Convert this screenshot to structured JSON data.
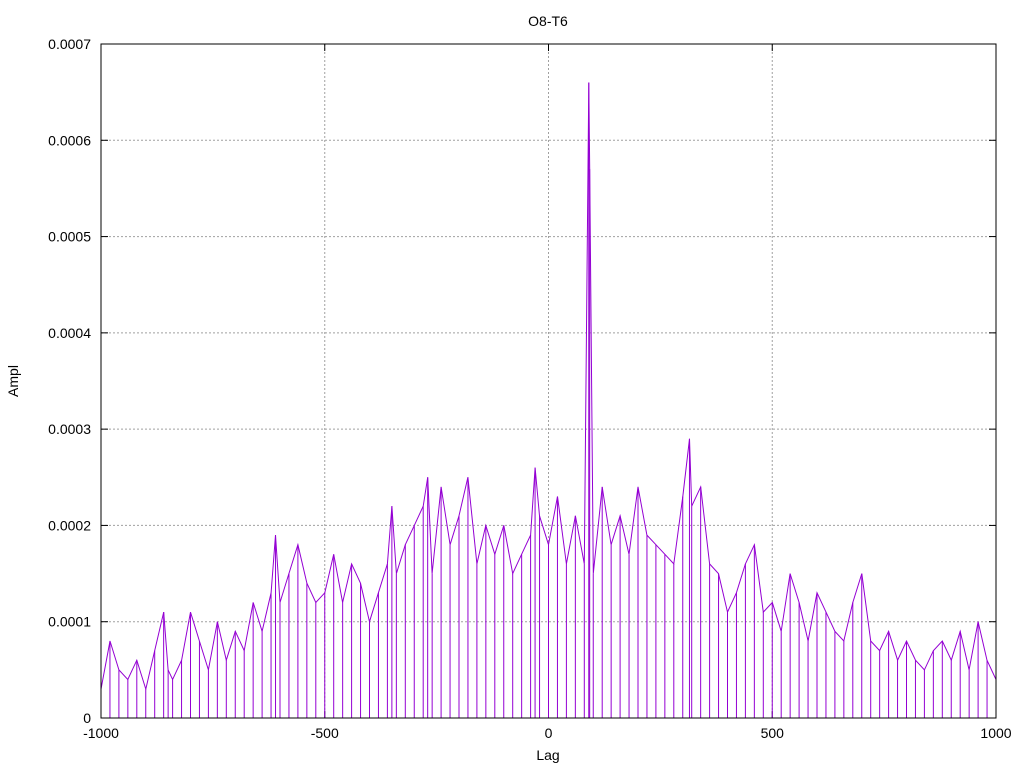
{
  "chart_data": {
    "type": "line",
    "title": "O8-T6",
    "xlabel": "Lag",
    "ylabel": "Ampl",
    "xlim": [
      -1000,
      1000
    ],
    "ylim": [
      0,
      0.0007
    ],
    "x_ticks": [
      -1000,
      -500,
      0,
      500,
      1000
    ],
    "x_tick_labels": [
      "-1000",
      "-500",
      "0",
      "500",
      "1000"
    ],
    "y_ticks": [
      0,
      0.0001,
      0.0002,
      0.0003,
      0.0004,
      0.0005,
      0.0006,
      0.0007
    ],
    "y_tick_labels": [
      "0",
      "0.0001",
      "0.0002",
      "0.0003",
      "0.0004",
      "0.0005",
      "0.0006",
      "0.0007"
    ],
    "grid": true,
    "line_color": "#9400d3",
    "series": [
      {
        "x": [
          -1000,
          -980,
          -960,
          -940,
          -920,
          -900,
          -880,
          -860,
          -850,
          -840,
          -820,
          -800,
          -780,
          -760,
          -740,
          -720,
          -700,
          -680,
          -660,
          -640,
          -620,
          -610,
          -600,
          -580,
          -560,
          -540,
          -520,
          -500,
          -480,
          -460,
          -440,
          -420,
          -400,
          -380,
          -360,
          -350,
          -340,
          -320,
          -300,
          -280,
          -270,
          -260,
          -240,
          -220,
          -200,
          -180,
          -160,
          -140,
          -120,
          -100,
          -80,
          -60,
          -40,
          -30,
          -20,
          0,
          20,
          40,
          60,
          80,
          90,
          92,
          100,
          120,
          140,
          160,
          180,
          200,
          220,
          240,
          260,
          280,
          300,
          315,
          320,
          340,
          360,
          380,
          400,
          420,
          440,
          460,
          480,
          500,
          520,
          540,
          560,
          580,
          600,
          620,
          640,
          660,
          680,
          700,
          720,
          740,
          760,
          780,
          800,
          820,
          840,
          860,
          880,
          900,
          920,
          940,
          960,
          980,
          1000
        ],
        "values": [
          3e-05,
          8e-05,
          5e-05,
          4e-05,
          6e-05,
          3e-05,
          7e-05,
          0.00011,
          5e-05,
          4e-05,
          6e-05,
          0.00011,
          8e-05,
          5e-05,
          0.0001,
          6e-05,
          9e-05,
          7e-05,
          0.00012,
          9e-05,
          0.00013,
          0.00019,
          0.00012,
          0.00015,
          0.00018,
          0.00014,
          0.00012,
          0.00013,
          0.00017,
          0.00012,
          0.00016,
          0.00014,
          0.0001,
          0.00013,
          0.00016,
          0.00022,
          0.00015,
          0.00018,
          0.0002,
          0.00022,
          0.00025,
          0.00015,
          0.00024,
          0.00018,
          0.00021,
          0.00025,
          0.00016,
          0.0002,
          0.00017,
          0.0002,
          0.00015,
          0.00017,
          0.00019,
          0.00026,
          0.00021,
          0.00018,
          0.00023,
          0.00016,
          0.00021,
          0.00016,
          0.00066,
          0.00057,
          0.00015,
          0.00024,
          0.00018,
          0.00021,
          0.00017,
          0.00024,
          0.00019,
          0.00018,
          0.00017,
          0.00016,
          0.00023,
          0.00029,
          0.00022,
          0.00024,
          0.00016,
          0.00015,
          0.00011,
          0.00013,
          0.00016,
          0.00018,
          0.00011,
          0.00012,
          9e-05,
          0.00015,
          0.00012,
          8e-05,
          0.00013,
          0.00011,
          9e-05,
          8e-05,
          0.00012,
          0.00015,
          8e-05,
          7e-05,
          9e-05,
          6e-05,
          8e-05,
          6e-05,
          5e-05,
          7e-05,
          8e-05,
          6e-05,
          9e-05,
          5e-05,
          0.0001,
          6e-05,
          4e-05
        ]
      }
    ]
  }
}
